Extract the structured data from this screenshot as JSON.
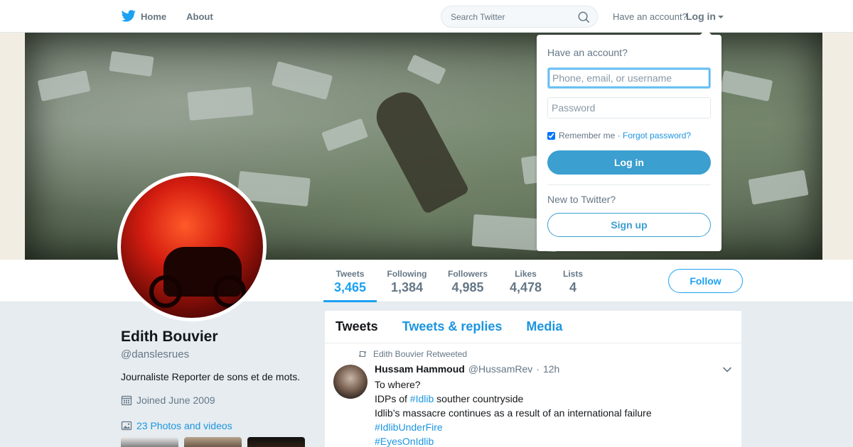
{
  "nav": {
    "home_label": "Home",
    "about_label": "About",
    "search_placeholder": "Search Twitter",
    "account_prompt": "Have an account?",
    "login_label": "Log in"
  },
  "profile": {
    "name": "Edith Bouvier",
    "handle": "@danslesrues",
    "bio": "Journaliste Reporter de sons et de mots.",
    "joined": "Joined June 2009",
    "photos_link": "23 Photos and videos",
    "stats": [
      {
        "label": "Tweets",
        "value": "3,465",
        "active": true
      },
      {
        "label": "Following",
        "value": "1,384"
      },
      {
        "label": "Followers",
        "value": "4,985"
      },
      {
        "label": "Likes",
        "value": "4,478"
      },
      {
        "label": "Lists",
        "value": "4"
      }
    ],
    "follow_label": "Follow"
  },
  "timeline": {
    "tabs": [
      "Tweets",
      "Tweets & replies",
      "Media"
    ],
    "tweet": {
      "retweet_context": "Edith Bouvier Retweeted",
      "author_name": "Hussam Hammoud",
      "author_handle": "@HussamRev",
      "dot": "·",
      "time": "12h",
      "line1": "To where?",
      "line2_prefix": "IDPs of ",
      "line2_tag": "#Idlib",
      "line2_suffix": " souther countryside",
      "line3": "Idlib’s massacre continues as a result of an international failure",
      "tag1": "#IdlibUnderFire",
      "tag2": "#EyesOnIdlib"
    }
  },
  "login_dropdown": {
    "title": "Have an account?",
    "username_placeholder": "Phone, email, or username",
    "password_placeholder": "Password",
    "remember_label": "Remember me",
    "separator": "·",
    "forgot_label": "Forgot password?",
    "login_button": "Log in",
    "new_prompt": "New to Twitter?",
    "signup_button": "Sign up"
  },
  "colors": {
    "accent": "#1da1f2",
    "link": "#1b95e0",
    "login_button": "#3b9fd0",
    "page_bg": "#e6ecf0"
  }
}
